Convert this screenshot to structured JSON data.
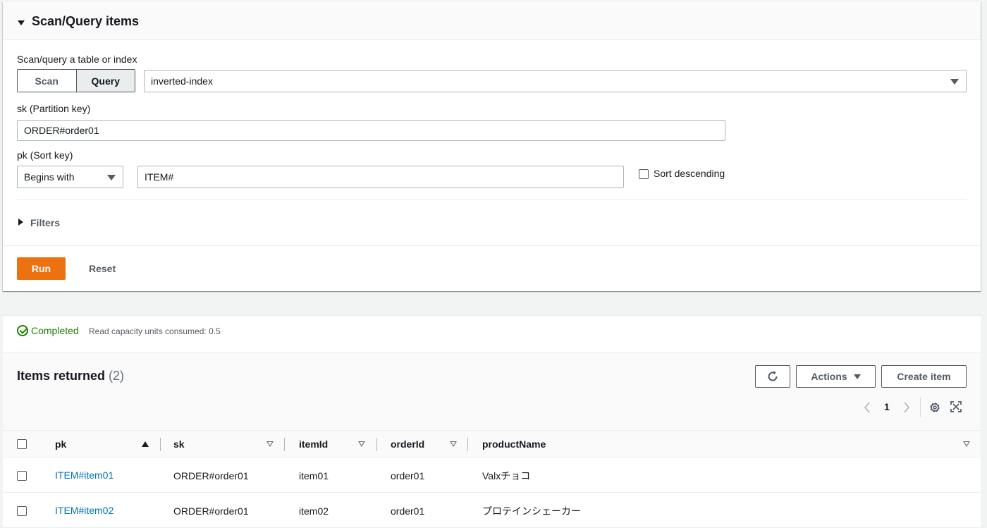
{
  "scan_panel": {
    "title": "Scan/Query items",
    "mode_label": "Scan/query a table or index",
    "modes": [
      "Scan",
      "Query"
    ],
    "active_mode": "Query",
    "index_select": "inverted-index",
    "partition_key_label": "sk (Partition key)",
    "partition_key_value": "ORDER#order01",
    "sort_key_label": "pk (Sort key)",
    "sort_condition": "Begins with",
    "sort_key_value": "ITEM#",
    "sort_descending_label": "Sort descending",
    "filters_label": "Filters",
    "run_label": "Run",
    "reset_label": "Reset"
  },
  "results": {
    "status": "Completed",
    "capacity_text": "Read capacity units consumed: 0.5",
    "items_title": "Items returned",
    "items_count": "(2)",
    "actions_label": "Actions",
    "create_label": "Create item",
    "page_number": "1",
    "columns": [
      "pk",
      "sk",
      "itemId",
      "orderId",
      "productName"
    ],
    "rows": [
      {
        "pk": "ITEM#item01",
        "sk": "ORDER#order01",
        "itemId": "item01",
        "orderId": "order01",
        "productName": "Valxチョコ"
      },
      {
        "pk": "ITEM#item02",
        "sk": "ORDER#order01",
        "itemId": "item02",
        "orderId": "order01",
        "productName": "プロテインシェーカー"
      }
    ]
  },
  "colors": {
    "accent": "#ec7211",
    "link": "#0073bb",
    "success": "#1d8102"
  },
  "icons": [
    "caret-down-icon",
    "caret-right-icon",
    "check-circle-icon",
    "refresh-icon",
    "chevron-left-icon",
    "chevron-right-icon",
    "gear-icon",
    "fullscreen-icon"
  ]
}
